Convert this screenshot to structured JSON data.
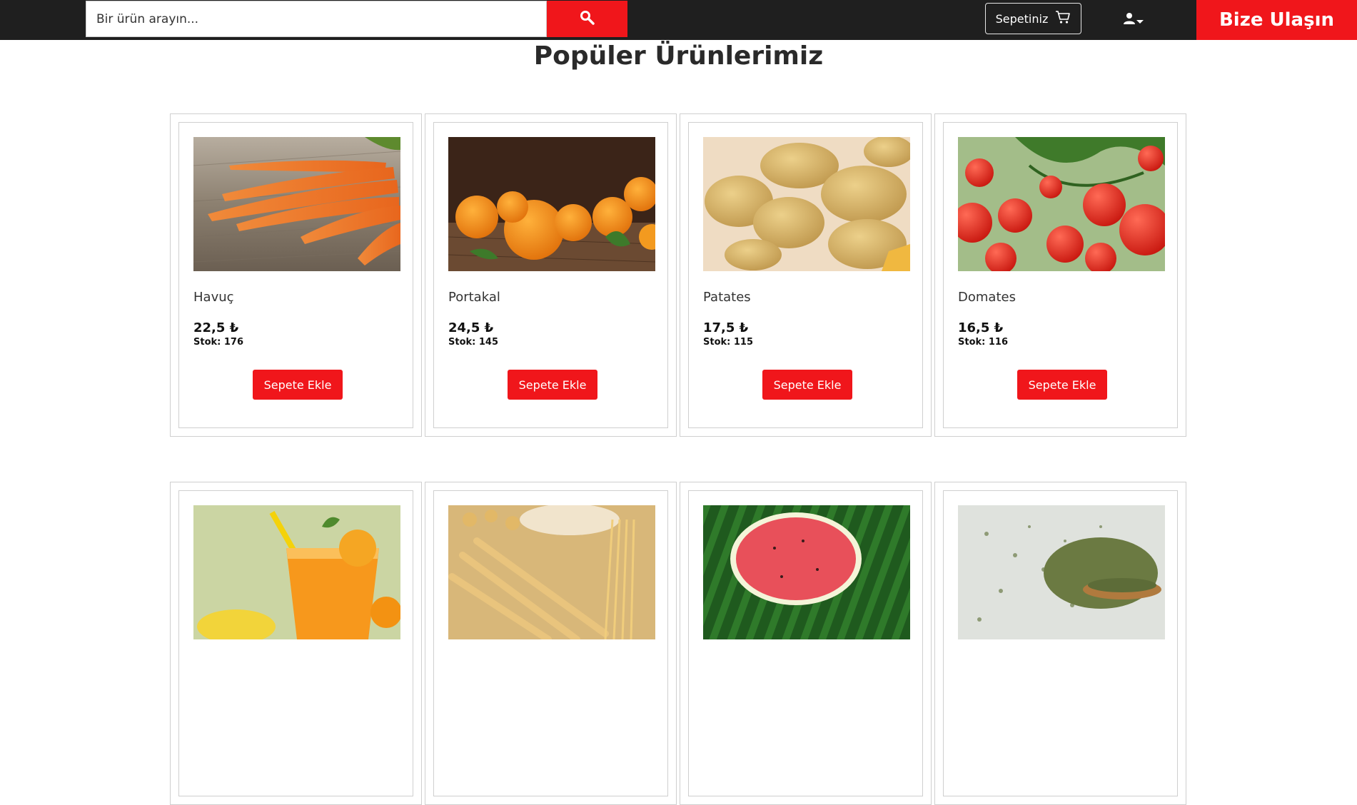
{
  "header": {
    "search_placeholder": "Bir ürün arayın...",
    "search_icon": "search-icon",
    "cart_label": "Sepetiniz",
    "cart_icon": "cart-icon",
    "user_icon": "user-icon",
    "contact_label": "Bize Ulaşın"
  },
  "section_title": "Popüler Ürünlerimiz",
  "products": [
    {
      "name": "Havuç",
      "price": "22,5 ₺",
      "stock": "Stok: 176",
      "button": "Sepete Ekle",
      "image": "carrots-image"
    },
    {
      "name": "Portakal",
      "price": "24,5 ₺",
      "stock": "Stok: 145",
      "button": "Sepete Ekle",
      "image": "oranges-image"
    },
    {
      "name": "Patates",
      "price": "17,5 ₺",
      "stock": "Stok: 115",
      "button": "Sepete Ekle",
      "image": "potatoes-image"
    },
    {
      "name": "Domates",
      "price": "16,5 ₺",
      "stock": "Stok: 116",
      "button": "Sepete Ekle",
      "image": "tomatoes-image"
    },
    {
      "image": "orange-juice-image"
    },
    {
      "image": "pasta-image"
    },
    {
      "image": "watermelon-image"
    },
    {
      "image": "dried-herbs-image"
    }
  ],
  "colors": {
    "topbar": "#1f1f1f",
    "accent_red": "#f0161b"
  }
}
